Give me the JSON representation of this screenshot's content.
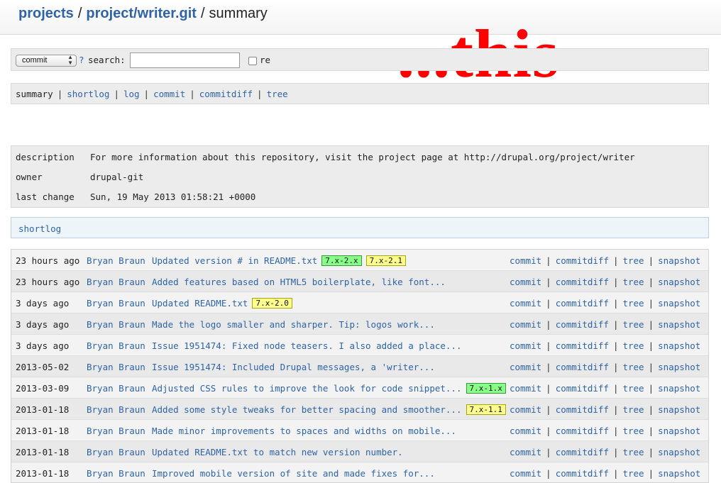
{
  "header": {
    "crumb_projects": "projects",
    "crumb_sep1": "/",
    "crumb_repo": "project/writer.git",
    "crumb_sep2": "/",
    "crumb_page": "summary"
  },
  "overlay_text": "...this",
  "search": {
    "select_value": "commit",
    "help": "?",
    "label": "search:",
    "value": "",
    "re_label": "re"
  },
  "nav": {
    "items": [
      "summary",
      "shortlog",
      "log",
      "commit",
      "commitdiff",
      "tree"
    ],
    "separator": "|"
  },
  "project": {
    "description_label": "description",
    "description": "For more information about this repository, visit the project page at http://drupal.org/project/writer",
    "owner_label": "owner",
    "owner": "drupal-git",
    "last_change_label": "last change",
    "last_change": "Sun, 19 May 2013 01:58:21 +0000"
  },
  "shortlog_title": "shortlog",
  "row_links": [
    "commit",
    "commitdiff",
    "tree",
    "snapshot"
  ],
  "tag_colors": {
    "yellow": "#ffff90",
    "green": "#88ff88"
  },
  "commits": [
    {
      "age": "23 hours ago",
      "author": "Bryan Braun",
      "subject": "Updated version # in README.txt",
      "tags": [
        {
          "label": "7.x-2.x",
          "color": "green"
        },
        {
          "label": "7.x-2.1",
          "color": "yellow"
        }
      ]
    },
    {
      "age": "23 hours ago",
      "author": "Bryan Braun",
      "subject": "Added features based on HTML5 boilerplate, like font...",
      "tags": []
    },
    {
      "age": "3 days ago",
      "author": "Bryan Braun",
      "subject": "Updated README.txt",
      "tags": [
        {
          "label": "7.x-2.0",
          "color": "yellow"
        }
      ]
    },
    {
      "age": "3 days ago",
      "author": "Bryan Braun",
      "subject": "Made the logo smaller and sharper. Tip: logos work...",
      "tags": []
    },
    {
      "age": "3 days ago",
      "author": "Bryan Braun",
      "subject": "Issue 1951474: Fixed node teasers. I also added a place...",
      "tags": []
    },
    {
      "age": "2013-05-02",
      "author": "Bryan Braun",
      "subject": "Issue 1951474: Included Drupal messages, a 'writer...",
      "tags": []
    },
    {
      "age": "2013-03-09",
      "author": "Bryan Braun",
      "subject": "Adjusted CSS rules to improve the look for code snippet...",
      "tags": [
        {
          "label": "7.x-1.x",
          "color": "green"
        }
      ]
    },
    {
      "age": "2013-01-18",
      "author": "Bryan Braun",
      "subject": "Added some style tweaks for better spacing and smoother...",
      "tags": [
        {
          "label": "7.x-1.1",
          "color": "yellow"
        }
      ]
    },
    {
      "age": "2013-01-18",
      "author": "Bryan Braun",
      "subject": "Made minor improvements to spaces and widths on mobile...",
      "tags": []
    },
    {
      "age": "2013-01-18",
      "author": "Bryan Braun",
      "subject": "Updated README.txt to match new version number.",
      "tags": []
    },
    {
      "age": "2013-01-18",
      "author": "Bryan Braun",
      "subject": "Improved mobile version of site and made fixes for...",
      "tags": []
    }
  ]
}
